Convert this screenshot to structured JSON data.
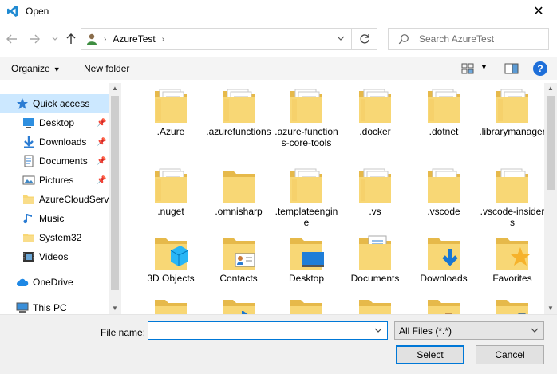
{
  "window": {
    "title": "Open",
    "close_glyph": "✕"
  },
  "nav": {
    "address_segment": "AzureTest",
    "search_placeholder": "Search AzureTest"
  },
  "toolbar": {
    "organize_label": "Organize",
    "new_folder_label": "New folder",
    "help_label": "?"
  },
  "sidebar": {
    "items": [
      {
        "label": "Quick access",
        "icon": "star-icon",
        "pinned": false,
        "selected": true,
        "indent": 1
      },
      {
        "label": "Desktop",
        "icon": "desktop-icon",
        "pinned": true,
        "selected": false,
        "indent": 2
      },
      {
        "label": "Downloads",
        "icon": "download-icon",
        "pinned": true,
        "selected": false,
        "indent": 2
      },
      {
        "label": "Documents",
        "icon": "documents-icon",
        "pinned": true,
        "selected": false,
        "indent": 2
      },
      {
        "label": "Pictures",
        "icon": "pictures-icon",
        "pinned": true,
        "selected": false,
        "indent": 2
      },
      {
        "label": "AzureCloudServi",
        "icon": "folder-icon",
        "pinned": false,
        "selected": false,
        "indent": 2
      },
      {
        "label": "Music",
        "icon": "music-icon",
        "pinned": false,
        "selected": false,
        "indent": 2
      },
      {
        "label": "System32",
        "icon": "folder-icon",
        "pinned": false,
        "selected": false,
        "indent": 2
      },
      {
        "label": "Videos",
        "icon": "videos-icon",
        "pinned": false,
        "selected": false,
        "indent": 2
      },
      {
        "label": "OneDrive",
        "icon": "cloud-icon",
        "pinned": false,
        "selected": false,
        "indent": 1
      },
      {
        "label": "This PC",
        "icon": "computer-icon",
        "pinned": false,
        "selected": false,
        "indent": 1
      }
    ]
  },
  "files": [
    {
      "label": ".Azure",
      "kind": "docs"
    },
    {
      "label": ".azurefunctions",
      "kind": "docs"
    },
    {
      "label": ".azure-functions-core-tools",
      "kind": "docs"
    },
    {
      "label": ".docker",
      "kind": "docs"
    },
    {
      "label": ".dotnet",
      "kind": "docs"
    },
    {
      "label": ".librarymanager",
      "kind": "docs"
    },
    {
      "label": ".nuget",
      "kind": "docs"
    },
    {
      "label": ".omnisharp",
      "kind": "plain"
    },
    {
      "label": ".templateengine",
      "kind": "docs"
    },
    {
      "label": ".vs",
      "kind": "docs"
    },
    {
      "label": ".vscode",
      "kind": "plain-white"
    },
    {
      "label": ".vscode-insiders",
      "kind": "code"
    },
    {
      "label": "3D Objects",
      "kind": "3d"
    },
    {
      "label": "Contacts",
      "kind": "contacts"
    },
    {
      "label": "Desktop",
      "kind": "desktop"
    },
    {
      "label": "Documents",
      "kind": "documents"
    },
    {
      "label": "Downloads",
      "kind": "downloads"
    },
    {
      "label": "Favorites",
      "kind": "favorites"
    },
    {
      "label": "",
      "kind": "links"
    },
    {
      "label": "",
      "kind": "music"
    },
    {
      "label": "",
      "kind": "onedrive"
    },
    {
      "label": "",
      "kind": "pictures"
    },
    {
      "label": "",
      "kind": "saved-games"
    },
    {
      "label": "",
      "kind": "searches"
    }
  ],
  "bottom": {
    "filename_label": "File name:",
    "filename_value": "",
    "filetype_value": "All Files (*.*)",
    "select_label": "Select",
    "cancel_label": "Cancel"
  },
  "colors": {
    "selection": "#cce8ff",
    "accent": "#0078d7",
    "folder": "#f8d775",
    "folder_dark": "#e6b94a"
  }
}
